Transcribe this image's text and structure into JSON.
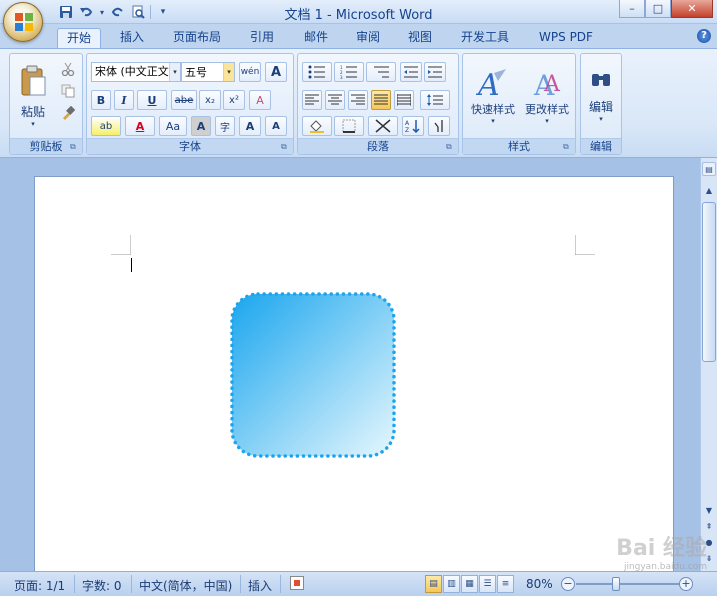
{
  "window": {
    "title": "文档 1 - Microsoft Word",
    "controls": {
      "minimize": "–",
      "maximize": "□",
      "close": "✕"
    }
  },
  "qat": {
    "items": [
      {
        "name": "save-icon",
        "glyph": "💾"
      },
      {
        "name": "undo-icon",
        "glyph": "↶"
      },
      {
        "name": "dropdown-icon",
        "glyph": "▾"
      },
      {
        "name": "redo-icon",
        "glyph": "↷"
      },
      {
        "name": "print-preview-icon",
        "glyph": "🔍"
      },
      {
        "name": "customize-icon",
        "glyph": "▾"
      }
    ]
  },
  "tabs": [
    "开始",
    "插入",
    "页面布局",
    "引用",
    "邮件",
    "审阅",
    "视图",
    "开发工具",
    "WPS PDF"
  ],
  "active_tab": "开始",
  "help": "?",
  "ribbon": {
    "clipboard": {
      "label": "剪贴板",
      "paste": "粘贴"
    },
    "font": {
      "label": "字体",
      "font_name": "宋体 (中文正文",
      "font_size": "五号",
      "phonetic": "wén",
      "char_border": "A",
      "bold": "B",
      "italic": "I",
      "underline": "U",
      "strike": "abe",
      "sub": "x₂",
      "sup": "x²",
      "clear": "A",
      "highlight": "ab",
      "font_color": "A",
      "change_case": "Aa",
      "shade": "A",
      "enclose": "字",
      "grow": "A",
      "shrink": "A"
    },
    "paragraph": {
      "label": "段落"
    },
    "styles": {
      "label": "样式",
      "quick": "快速样式",
      "change": "更改样式"
    },
    "editing": {
      "label": "编辑"
    }
  },
  "status": {
    "page": "页面: 1/1",
    "words": "字数: 0",
    "language": "中文(简体，中国)",
    "insert": "插入",
    "zoom": "80%"
  },
  "shape": {
    "fill_start": "#1aa6ee",
    "fill_end": "#e6f7fd",
    "border_color": "#1aa6ee"
  },
  "watermark": {
    "text": "Bai 经验",
    "sub": "jingyan.baidu.com"
  }
}
